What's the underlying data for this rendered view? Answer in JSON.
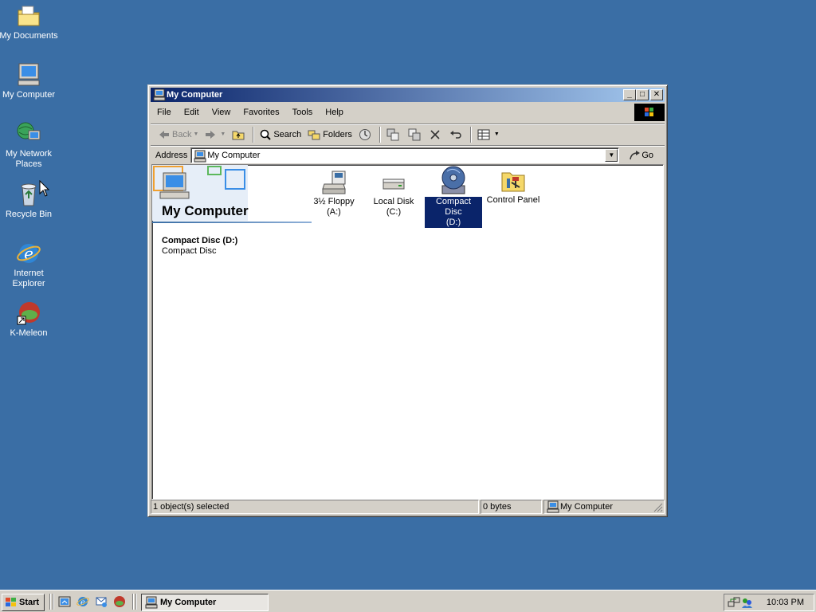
{
  "desktop": {
    "icons": [
      {
        "label": "My Documents",
        "icon": "folder-documents-icon"
      },
      {
        "label": "My Computer",
        "icon": "computer-icon"
      },
      {
        "label": "My Network\nPlaces",
        "icon": "network-places-icon"
      },
      {
        "label": "Recycle Bin",
        "icon": "recycle-bin-icon"
      },
      {
        "label": "Internet\nExplorer",
        "icon": "internet-explorer-icon"
      },
      {
        "label": "K-Meleon",
        "icon": "k-meleon-icon"
      }
    ]
  },
  "window": {
    "title": "My Computer",
    "buttons": {
      "minimize": "_",
      "maximize": "□",
      "close": "✕"
    },
    "menu": [
      "File",
      "Edit",
      "View",
      "Favorites",
      "Tools",
      "Help"
    ],
    "toolbar": {
      "back": "Back",
      "search": "Search",
      "folders": "Folders"
    },
    "address": {
      "label": "Address",
      "value": "My Computer",
      "go": "Go"
    },
    "panel": {
      "title": "My Computer",
      "selected_name": "Compact Disc (D:)",
      "selected_type": "Compact Disc"
    },
    "items": [
      {
        "label": "3½ Floppy\n(A:)",
        "icon": "floppy-drive-icon",
        "selected": false
      },
      {
        "label": "Local Disk (C:)",
        "icon": "hard-disk-icon",
        "selected": false
      },
      {
        "label": "Compact Disc\n(D:)",
        "icon": "cd-drive-icon",
        "selected": true
      },
      {
        "label": "Control Panel",
        "icon": "control-panel-icon",
        "selected": false
      }
    ],
    "status": {
      "selection": "1 object(s) selected",
      "size": "0 bytes",
      "zone": "My Computer"
    }
  },
  "taskbar": {
    "start": "Start",
    "task": "My Computer",
    "clock": "10:03 PM"
  },
  "colors": {
    "desktop": "#3a6ea5",
    "title_active": "#0a246a",
    "selection": "#0a246a"
  }
}
